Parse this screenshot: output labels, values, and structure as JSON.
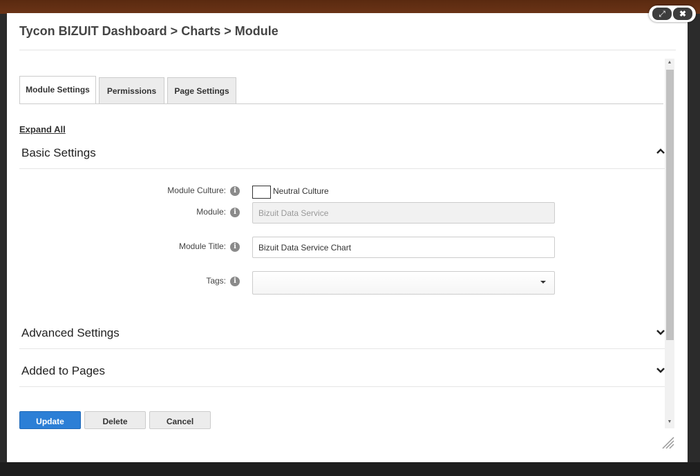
{
  "window": {
    "title": "Tycon BIZUIT Dashboard > Charts > Module",
    "expand_icon": "⤢",
    "close_icon": "✖"
  },
  "tabs": [
    {
      "label": "Module Settings",
      "active": true
    },
    {
      "label": "Permissions",
      "active": false
    },
    {
      "label": "Page Settings",
      "active": false
    }
  ],
  "expand_all": "Expand All",
  "sections": {
    "basic": {
      "label": "Basic Settings",
      "expanded": true
    },
    "advanced": {
      "label": "Advanced Settings",
      "expanded": false
    },
    "added": {
      "label": "Added to Pages",
      "expanded": false
    }
  },
  "fields": {
    "culture": {
      "label": "Module Culture:",
      "checkbox_text": "Neutral Culture"
    },
    "module": {
      "label": "Module:",
      "value": "Bizuit Data Service"
    },
    "title": {
      "label": "Module Title:",
      "value": "Bizuit Data Service Chart"
    },
    "tags": {
      "label": "Tags:",
      "value": ""
    }
  },
  "buttons": {
    "update": "Update",
    "delete": "Delete",
    "cancel": "Cancel"
  },
  "colors": {
    "primary": "#2c7fd6",
    "header_bar": "#6b3417"
  }
}
